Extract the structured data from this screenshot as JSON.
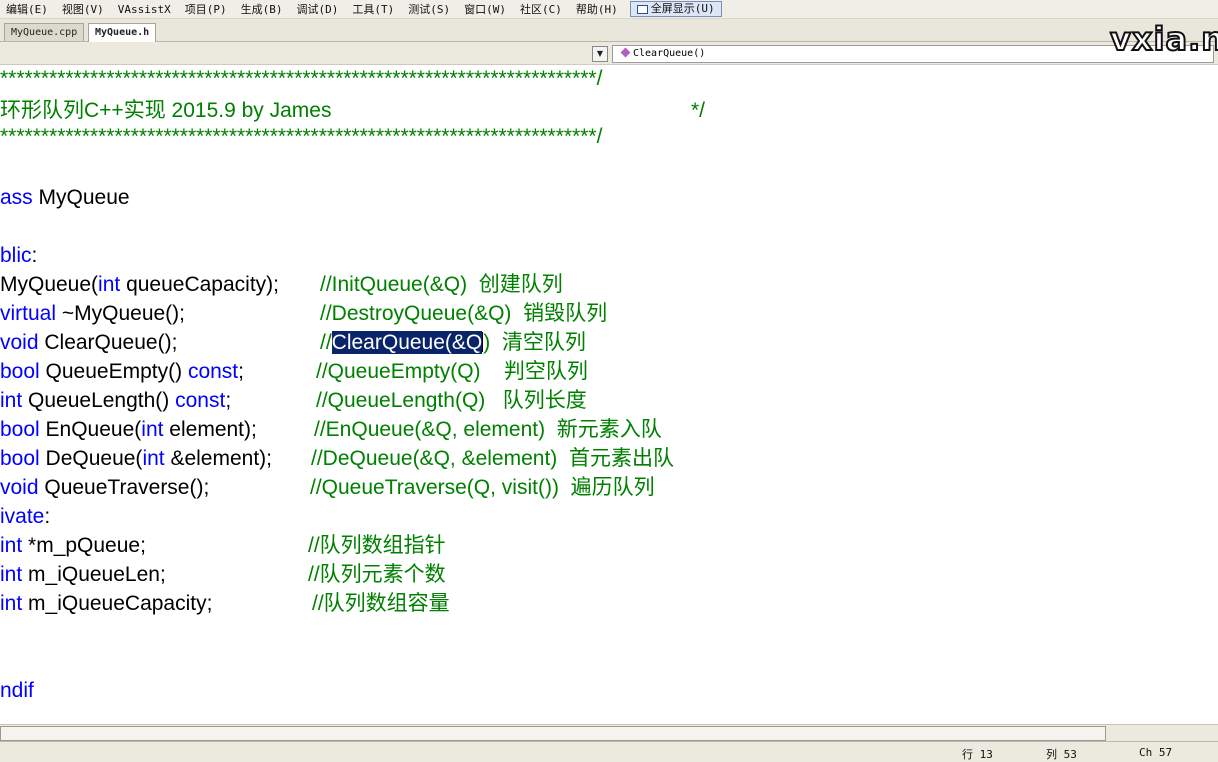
{
  "menubar": {
    "items": [
      "编辑(E)",
      "视图(V)",
      "VAssistX",
      "项目(P)",
      "生成(B)",
      "调试(D)",
      "工具(T)",
      "测试(S)",
      "窗口(W)",
      "社区(C)",
      "帮助(H)"
    ],
    "fullscreen": "全屏显示(U)"
  },
  "tabs": [
    {
      "label": "MyQueue.cpp",
      "active": false
    },
    {
      "label": "MyQueue.h",
      "active": true
    }
  ],
  "nav": {
    "member": "ClearQueue()"
  },
  "watermark": "vxia.ne",
  "code": {
    "stars1": "*************************************************************************/",
    "title_text": "环形队列C++实现 2015.9 by James",
    "title_end": "*/",
    "stars2": "*************************************************************************/",
    "class_kw": "ass",
    "class_name": " MyQueue",
    "public_kw": "blic",
    "public_colon": ":",
    "l1_code": "MyQueue(",
    "l1_kw": "int",
    "l1_rest": " queueCapacity);",
    "l1_cm": "//InitQueue(&Q)  创建队列",
    "l2_kw": "virtual",
    "l2_rest": " ~MyQueue();",
    "l2_cm": "//DestroyQueue(&Q)  销毁队列",
    "l3_kw": "void",
    "l3_rest": " ClearQueue();",
    "l3_cm_pre": "//",
    "l3_sel": "ClearQueue(&Q",
    "l3_cm_post": ")  清空队列",
    "l4_kw": "bool",
    "l4_rest": " QueueEmpty() ",
    "l4_kw2": "const",
    "l4_semi": ";",
    "l4_cm": "//QueueEmpty(Q)    判空队列",
    "l5_kw": "int",
    "l5_rest": " QueueLength() ",
    "l5_kw2": "const",
    "l5_semi": ";",
    "l5_cm": "//QueueLength(Q)   队列长度",
    "l6_kw": "bool",
    "l6_rest": " EnQueue(",
    "l6_kw2": "int",
    "l6_rest2": " element);",
    "l6_cm": "//EnQueue(&Q, element)  新元素入队",
    "l7_kw": "bool",
    "l7_rest": " DeQueue(",
    "l7_kw2": "int",
    "l7_rest2": " &element);",
    "l7_cm": "//DeQueue(&Q, &element)  首元素出队",
    "l8_kw": "void",
    "l8_rest": " QueueTraverse();",
    "l8_cm": "//QueueTraverse(Q, visit())  遍历队列",
    "private_kw": "ivate",
    "private_colon": ":",
    "m1_kw": "int",
    "m1_rest": " *m_pQueue;",
    "m1_cm": "//队列数组指针",
    "m2_kw": "int",
    "m2_rest": " m_iQueueLen;",
    "m2_cm": "//队列元素个数",
    "m3_kw": "int",
    "m3_rest": " m_iQueueCapacity;",
    "m3_cm": "//队列数组容量",
    "endif_kw": "ndif"
  },
  "status": {
    "line": "行 13",
    "col": "列 53",
    "ch": "Ch 57"
  },
  "colors": {
    "keyword": "#0000ff",
    "comment": "#008000",
    "selection": "#0a246a"
  }
}
